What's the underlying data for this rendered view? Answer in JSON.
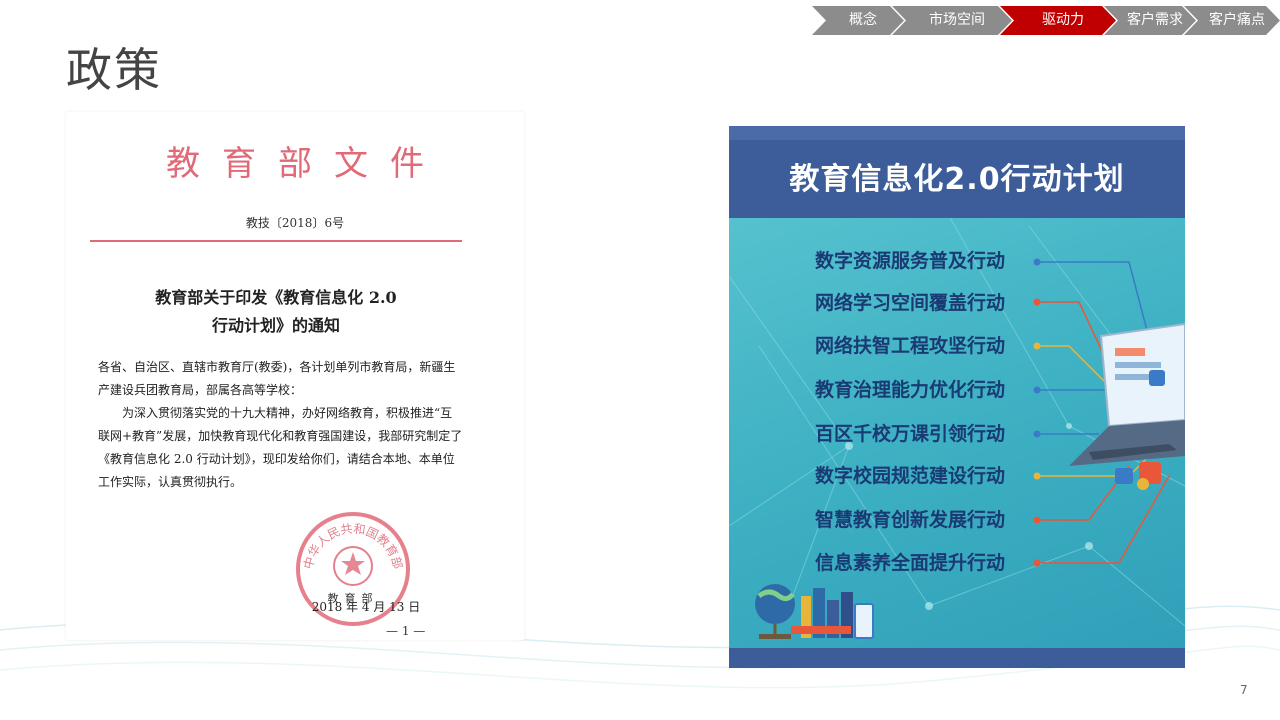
{
  "nav": {
    "items": [
      {
        "label": "概念",
        "color": "#8c8c8c"
      },
      {
        "label": "市场空间",
        "color": "#8c8c8c"
      },
      {
        "label": "驱动力",
        "color": "#c00000"
      },
      {
        "label": "客户需求",
        "color": "#8c8c8c"
      },
      {
        "label": "客户痛点",
        "color": "#8c8c8c"
      }
    ]
  },
  "slide": {
    "title": "政策",
    "page_number": "7"
  },
  "document": {
    "header": "教育部文件",
    "doc_number": "教技〔2018〕6号",
    "title_line1": "教育部关于印发《教育信息化 2.0",
    "title_line2": "行动计划》的通知",
    "body_p1": "各省、自治区、直辖市教育厅(教委)，各计划单列市教育局，新疆生产建设兵团教育局，部属各高等学校：",
    "body_p2": "为深入贯彻落实党的十九大精神，办好网络教育，积极推进“互联网+教育”发展，加快教育现代化和教育强国建设，我部研究制定了《教育信息化 2.0 行动计划》，现印发给你们，请结合本地、本单位工作实际，认真贯彻执行。",
    "seal_text": "中华人民共和国教育部",
    "seal_footer": "教育部",
    "date": "2018 年 4 月 13 日",
    "page_mark": "— 1 —",
    "accent_color": "#e06a78"
  },
  "poster": {
    "title": "教育信息化2.0行动计划",
    "items": [
      {
        "label": "数字资源服务普及行动",
        "dot": "#3a7bc8"
      },
      {
        "label": "网络学习空间覆盖行动",
        "dot": "#e8573a"
      },
      {
        "label": "网络扶智工程攻坚行动",
        "dot": "#e8b43a"
      },
      {
        "label": "教育治理能力优化行动",
        "dot": "#3a7bc8"
      },
      {
        "label": "百区千校万课引领行动",
        "dot": "#3a7bc8"
      },
      {
        "label": "数字校园规范建设行动",
        "dot": "#e8b43a"
      },
      {
        "label": "智慧教育创新发展行动",
        "dot": "#e8573a"
      },
      {
        "label": "信息素养全面提升行动",
        "dot": "#e8573a"
      }
    ],
    "header_color": "#3d5d9a",
    "text_color": "#1a3a74"
  }
}
